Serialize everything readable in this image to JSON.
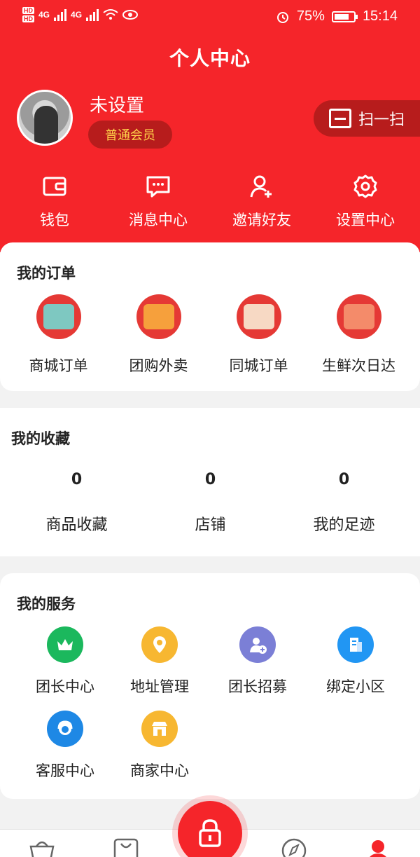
{
  "status_bar": {
    "battery": "75%",
    "time": "15:14",
    "hd1": "HD",
    "hd2": "HD",
    "net1": "4G",
    "net2": "4G"
  },
  "header": {
    "title": "个人中心"
  },
  "profile": {
    "name": "未设置",
    "member_level": "普通会员",
    "scan_label": "扫一扫"
  },
  "quick_actions": [
    {
      "label": "钱包",
      "icon": "wallet-icon"
    },
    {
      "label": "消息中心",
      "icon": "message-icon"
    },
    {
      "label": "邀请好友",
      "icon": "invite-user-icon"
    },
    {
      "label": "设置中心",
      "icon": "gear-icon"
    }
  ],
  "orders": {
    "title": "我的订单",
    "items": [
      {
        "label": "商城订单",
        "icon": "mall-order-icon"
      },
      {
        "label": "团购外卖",
        "icon": "group-buy-icon"
      },
      {
        "label": "同城订单",
        "icon": "local-order-icon"
      },
      {
        "label": "生鲜次日达",
        "icon": "fresh-food-icon"
      }
    ]
  },
  "favorites": {
    "title": "我的收藏",
    "items": [
      {
        "count": "0",
        "label": "商品收藏"
      },
      {
        "count": "0",
        "label": "店铺"
      },
      {
        "count": "0",
        "label": "我的足迹"
      }
    ]
  },
  "services": {
    "title": "我的服务",
    "items": [
      {
        "label": "团长中心",
        "icon": "crown-icon",
        "color": "#1bb85d"
      },
      {
        "label": "地址管理",
        "icon": "location-pin-icon",
        "color": "#f7b731"
      },
      {
        "label": "团长招募",
        "icon": "add-user-icon",
        "color": "#7b7fd6"
      },
      {
        "label": "绑定小区",
        "icon": "building-icon",
        "color": "#2196f3"
      },
      {
        "label": "客服中心",
        "icon": "customer-service-icon",
        "color": "#1e88e5"
      },
      {
        "label": "商家中心",
        "icon": "shop-icon",
        "color": "#f7b731"
      }
    ]
  },
  "colors": {
    "brand": "#f5252a",
    "badge_bg": "#b71c1c",
    "badge_text": "#ffd34a"
  }
}
